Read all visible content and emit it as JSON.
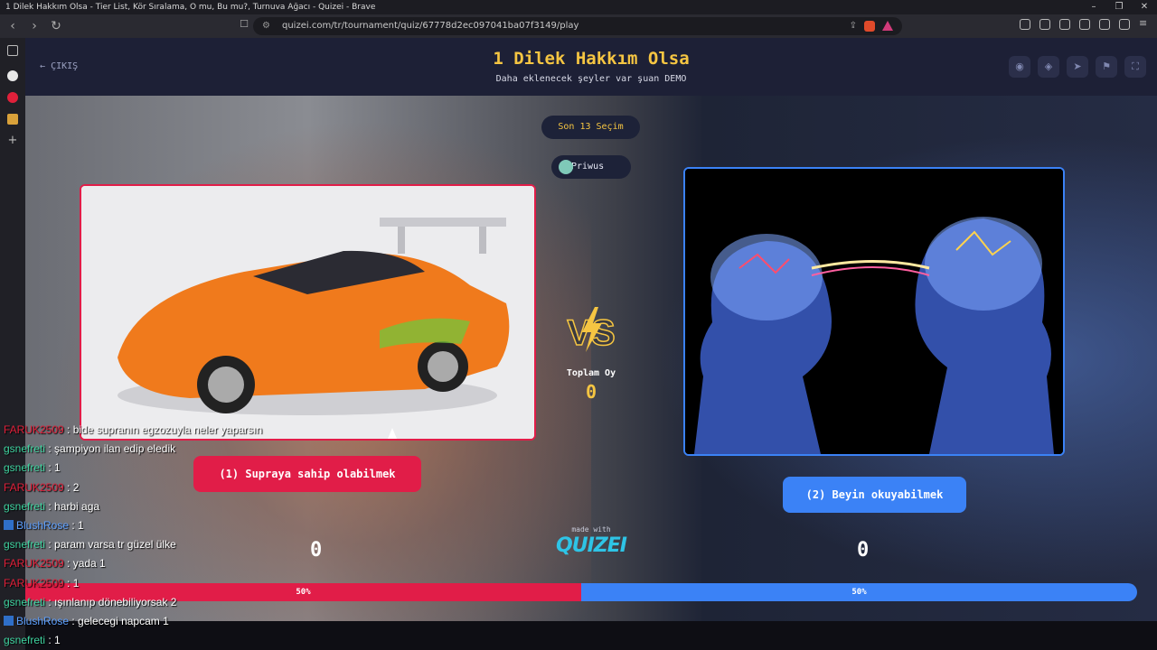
{
  "browser": {
    "window_title": "1 Dilek Hakkım Olsa - Tier List, Kör Sıralama, O mu, Bu mu?, Turnuva Ağacı - Quizei - Brave",
    "url": "quizei.com/tr/tournament/quiz/67778d2ec097041ba07f3149/play"
  },
  "header": {
    "exit_label": "ÇIKIŞ",
    "title": "1 Dilek Hakkım Olsa",
    "subtitle": "Daha eklenecek şeyler var şuan DEMO"
  },
  "round": {
    "label": "Son 13 Seçim",
    "creator": "Priwus"
  },
  "choices": [
    {
      "label": "(1) Supraya sahip olabilmek",
      "score": "0",
      "percent": "50%",
      "fraction": 0.5,
      "color": "#e11d48"
    },
    {
      "label": "(2) Beyin okuyabilmek",
      "score": "0",
      "percent": "50%",
      "fraction": 0.5,
      "color": "#3b82f6"
    }
  ],
  "total": {
    "label": "Toplam Oy",
    "value": "0"
  },
  "branding": {
    "made_with": "made with",
    "logo": "QUIZEI"
  },
  "icons": {
    "header_buttons": [
      "eye-icon",
      "share-icon",
      "send-icon",
      "flag-icon",
      "fullscreen-icon"
    ]
  },
  "chat": [
    {
      "user": "FARUK2509",
      "class": "u-far",
      "icon": false,
      "text": " : bide supranın egzozuyla neler yaparsın"
    },
    {
      "user": "gsnefreti",
      "class": "u-gsn",
      "icon": false,
      "text": " : şampiyon ilan edip eledik"
    },
    {
      "user": "gsnefreti",
      "class": "u-gsn",
      "icon": false,
      "text": " : 1"
    },
    {
      "user": "FARUK2509",
      "class": "u-far",
      "icon": false,
      "text": " : 2"
    },
    {
      "user": "gsnefreti",
      "class": "u-gsn",
      "icon": false,
      "text": " : harbi aga"
    },
    {
      "user": "BlushRose",
      "class": "u-blu",
      "icon": true,
      "text": " : 1"
    },
    {
      "user": "gsnefreti",
      "class": "u-gsn",
      "icon": false,
      "text": " : param varsa tr güzel ülke"
    },
    {
      "user": "FARUK2509",
      "class": "u-far",
      "icon": false,
      "text": " : yada 1"
    },
    {
      "user": "FARUK2509",
      "class": "u-far",
      "icon": false,
      "text": " : 1"
    },
    {
      "user": "gsnefreti",
      "class": "u-gsn",
      "icon": false,
      "text": " : ışınlanıp dönebiliyorsak 2"
    },
    {
      "user": "BlushRose",
      "class": "u-blu",
      "icon": true,
      "text": " : gelecegi napcam 1"
    },
    {
      "user": "gsnefreti",
      "class": "u-gsn",
      "icon": false,
      "text": " : 1"
    }
  ]
}
